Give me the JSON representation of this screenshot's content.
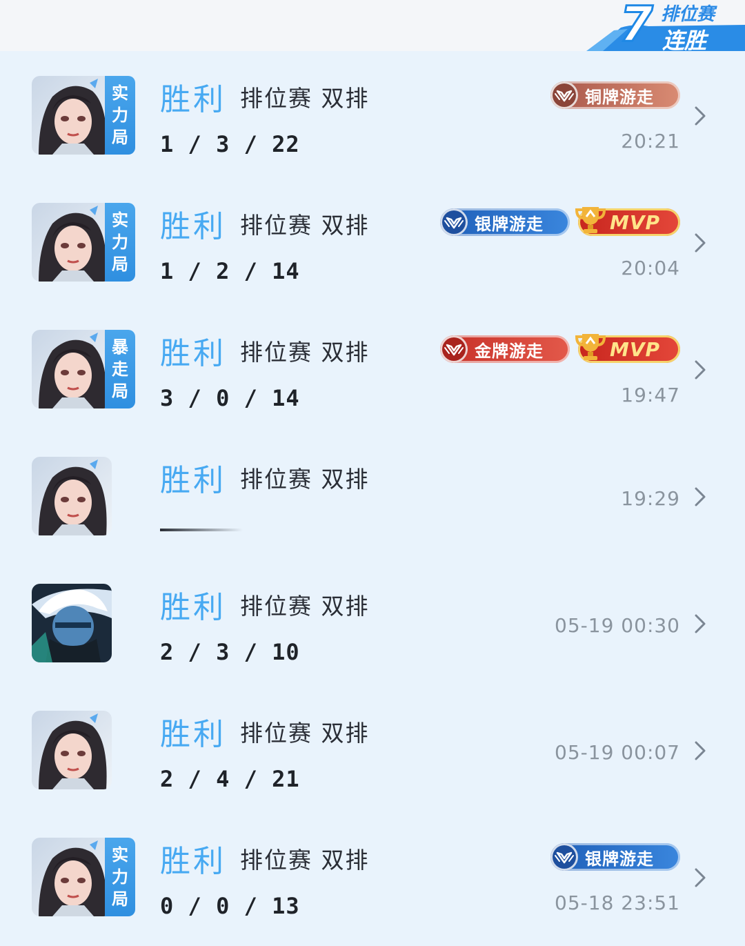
{
  "streak": {
    "count": "7",
    "mode": "排位赛",
    "label": "连胜"
  },
  "matches": [
    {
      "result": "胜利",
      "mode": "排位赛 双排",
      "kda": "1 / 3 / 22",
      "tag": [
        "实",
        "力",
        "局"
      ],
      "badges": [
        {
          "type": "bronze",
          "label": "铜牌游走"
        }
      ],
      "time": "20:21",
      "hero": "girl"
    },
    {
      "result": "胜利",
      "mode": "排位赛 双排",
      "kda": "1 / 2 / 14",
      "tag": [
        "实",
        "力",
        "局"
      ],
      "badges": [
        {
          "type": "silver",
          "label": "银牌游走"
        },
        {
          "type": "mvp",
          "label": "MVP"
        }
      ],
      "time": "20:04",
      "hero": "girl"
    },
    {
      "result": "胜利",
      "mode": "排位赛 双排",
      "kda": "3 / 0 / 14",
      "tag": [
        "暴",
        "走",
        "局"
      ],
      "badges": [
        {
          "type": "gold",
          "label": "金牌游走"
        },
        {
          "type": "mvp",
          "label": "MVP"
        }
      ],
      "time": "19:47",
      "hero": "girl"
    },
    {
      "result": "胜利",
      "mode": "排位赛 双排",
      "kda": "",
      "tag": [],
      "badges": [],
      "time": "19:29",
      "hero": "girl"
    },
    {
      "result": "胜利",
      "mode": "排位赛 双排",
      "kda": "2 / 3 / 10",
      "tag": [],
      "badges": [],
      "time": "05-19 00:30",
      "hero": "ninja"
    },
    {
      "result": "胜利",
      "mode": "排位赛 双排",
      "kda": "2 / 4 / 21",
      "tag": [],
      "badges": [],
      "time": "05-19 00:07",
      "hero": "girl"
    },
    {
      "result": "胜利",
      "mode": "排位赛 双排",
      "kda": "0 / 0 / 13",
      "tag": [
        "实",
        "力",
        "局"
      ],
      "badges": [
        {
          "type": "silver",
          "label": "银牌游走"
        }
      ],
      "time": "05-18 23:51",
      "hero": "girl"
    }
  ]
}
